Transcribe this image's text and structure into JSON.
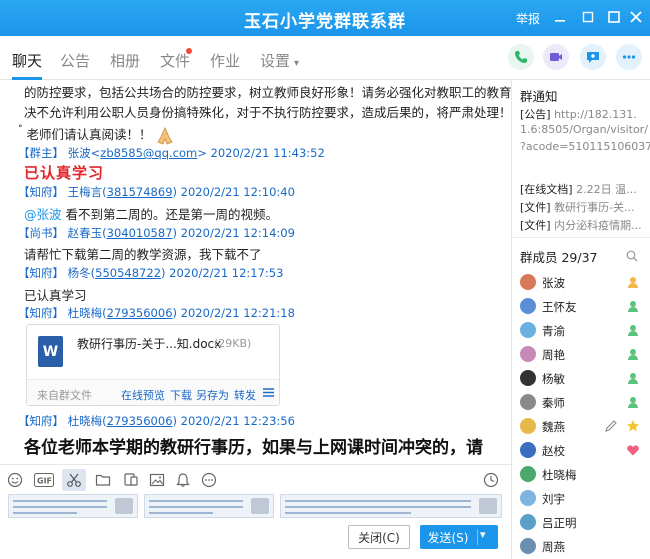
{
  "window": {
    "title": "玉石小学党群联系群",
    "report": "举报",
    "minimize_icon": "minimize-icon",
    "maximize_icon": "maximize-icon",
    "close_icon": "close-icon"
  },
  "tabs": [
    {
      "label": "聊天"
    },
    {
      "label": "公告"
    },
    {
      "label": "相册"
    },
    {
      "label": "文件"
    },
    {
      "label": "作业"
    },
    {
      "label": "设置"
    }
  ],
  "messages": {
    "line1": "的防控要求，包括公共场合的防控要求，树立教师良好形象！请务必强化对教职工的教育管理，",
    "line2": "决不允许利用公职人员身份搞特殊化，对于不执行防控要求，造成后果的，将严肃处理！",
    "line3": "老师们请认真阅读！！",
    "m1": {
      "role": "【群主】",
      "name": "张波",
      "contact": "zb8585@qq.com",
      "time": "2020/2/21 11:43:52",
      "text": "已认真学习"
    },
    "m2": {
      "role": "【知府】",
      "name": "王梅言",
      "contact": "381574869",
      "time": "2020/2/21 12:10:40",
      "mention": "@张波",
      "text": " 看不到第二周的。还是第一周的视频。"
    },
    "m3": {
      "role": "【尚书】",
      "name": "赵春玉",
      "contact": "304010587",
      "time": "2020/2/21 12:14:09",
      "text": "请帮忙下载第二周的教学资源，我下载不了"
    },
    "m4": {
      "role": "【知府】",
      "name": "杨冬",
      "contact": "550548722",
      "time": "2020/2/21 12:17:53",
      "text": "已认真学习"
    },
    "m5": {
      "role": "【知府】",
      "name": "杜晓梅",
      "contact": "279356006",
      "time": "2020/2/21 12:21:18"
    },
    "m6": {
      "role": "【知府】",
      "name": "杜晓梅",
      "contact": "279356006",
      "time": "2020/2/21 12:23:56",
      "text": "各位老师本学期的教研行事历，如果与上网课时间冲突的，请"
    }
  },
  "file": {
    "icon": "W",
    "name": "教研行事历-关于...知.docx",
    "size": "(29KB)",
    "source": "来自群文件",
    "actions": [
      "在线预览",
      "下载",
      "另存为",
      "转发"
    ]
  },
  "composer": {
    "close_label": "关闭(C)",
    "send_label": "发送(S)"
  },
  "sidebar": {
    "notice_title": "群通知",
    "notice_lines": [
      {
        "tag": "[公告]",
        "text": " http://182.131."
      },
      {
        "tag": "",
        "text": "1.6:8505/Organ/visitor/"
      },
      {
        "tag": "",
        "text": "?acode=510115106037"
      },
      {
        "tag": "[在线文档]",
        "text": " 2.22日 温..."
      },
      {
        "tag": "[文件]",
        "text": " 教研行事历-关..."
      },
      {
        "tag": "[文件]",
        "text": " 内分泌科疫情期..."
      }
    ],
    "members_title": "群成员 29/37",
    "members": [
      {
        "name": "张波",
        "avatar": "#d87a5a",
        "badge": "owner"
      },
      {
        "name": "王怀友",
        "avatar": "#5a8fd8",
        "badge": "admin"
      },
      {
        "name": "青渝",
        "avatar": "#6ab0e0",
        "badge": "admin"
      },
      {
        "name": "周艳",
        "avatar": "#c78ab8",
        "badge": "admin"
      },
      {
        "name": "杨敏",
        "avatar": "#333333",
        "badge": "admin"
      },
      {
        "name": "秦师",
        "avatar": "#8a8a8a",
        "badge": "admin"
      },
      {
        "name": "魏燕",
        "avatar": "#e6b94a",
        "badge": "star"
      },
      {
        "name": "赵校",
        "avatar": "#3a6fbf",
        "badge": "heart"
      },
      {
        "name": "杜晓梅",
        "avatar": "#4aa86a",
        "badge": ""
      },
      {
        "name": "刘宇",
        "avatar": "#7fb3e0",
        "badge": ""
      },
      {
        "name": "吕正明",
        "avatar": "#5aa0c8",
        "badge": ""
      },
      {
        "name": "周燕",
        "avatar": "#6b8fb0",
        "badge": ""
      }
    ]
  },
  "colors": {
    "accent": "#1b95ea",
    "link": "#1869c8",
    "red": "#e2262b"
  }
}
